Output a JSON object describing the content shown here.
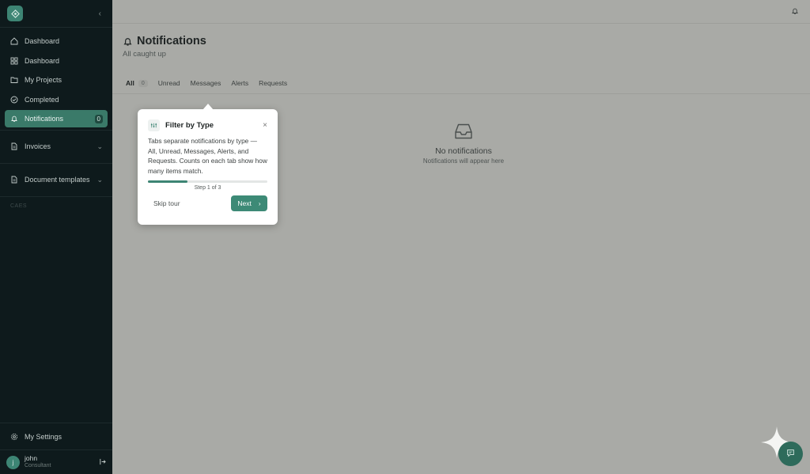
{
  "sidebar": {
    "nav": [
      {
        "label": "Dashboard",
        "icon": "home-icon"
      },
      {
        "label": "Dashboard",
        "icon": "grid-icon"
      },
      {
        "label": "My Projects",
        "icon": "folder-icon"
      },
      {
        "label": "Completed",
        "icon": "check-circle-icon"
      },
      {
        "label": "Notifications",
        "icon": "bell-icon",
        "badge": "0",
        "active": true
      }
    ],
    "sections": [
      {
        "label": "Invoices",
        "icon": "document-icon"
      },
      {
        "label": "Document templates",
        "icon": "document-icon"
      }
    ],
    "group_label": "CAES",
    "settings_label": "My Settings",
    "user": {
      "name": "john",
      "role": "Consultant",
      "initial": "j"
    }
  },
  "page": {
    "title": "Notifications",
    "subtitle": "All caught up"
  },
  "tabs": [
    {
      "label": "All",
      "count": "0",
      "active": true
    },
    {
      "label": "Unread"
    },
    {
      "label": "Messages"
    },
    {
      "label": "Alerts"
    },
    {
      "label": "Requests"
    }
  ],
  "empty_state": {
    "title": "No notifications",
    "subtitle": "Notifications will appear here"
  },
  "tour": {
    "title": "Filter by Type",
    "body": "Tabs separate notifications by type — All, Unread, Messages, Alerts, and Requests. Counts on each tab show how many items match.",
    "step_text": "Step 1 of 3",
    "progress": 0.333,
    "skip_label": "Skip tour",
    "next_label": "Next"
  },
  "colors": {
    "accent": "#3d8574",
    "sidebar_bg": "#0e1a1c",
    "overlay_bg": "#a9aaa6"
  }
}
